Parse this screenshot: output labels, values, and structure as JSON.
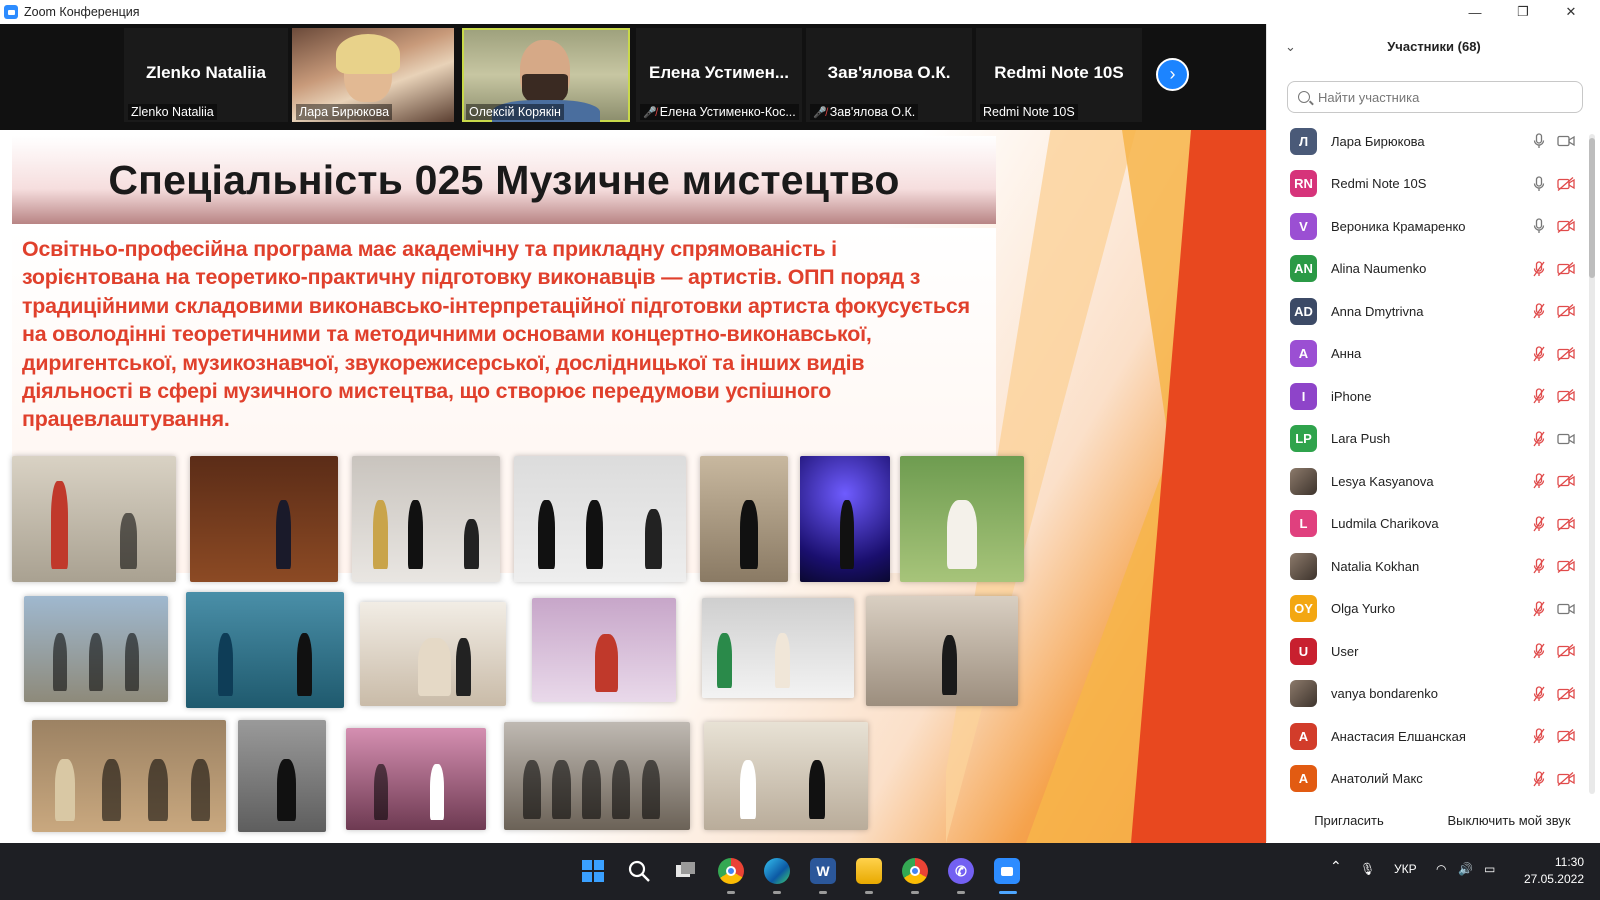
{
  "window": {
    "title": "Zoom Конференция",
    "minimize_icon": "minimize-icon",
    "restore_icon": "restore-icon",
    "close_icon": "close-icon"
  },
  "video_strip": {
    "tiles": [
      {
        "big_name": "Zlenko Nataliia",
        "label": "Zlenko Nataliia",
        "muted": false,
        "video": false
      },
      {
        "big_name": "",
        "label": "Лара Бирюкова",
        "muted": false,
        "video": true
      },
      {
        "big_name": "",
        "label": "Олексій Корякін",
        "muted": false,
        "video": true,
        "active": true
      },
      {
        "big_name": "Елена  Устимен...",
        "label": "Елена Устименко-Кос...",
        "muted": true,
        "video": false
      },
      {
        "big_name": "Зав'ялова О.К.",
        "label": "Зав'ялова О.К.",
        "muted": true,
        "video": false
      },
      {
        "big_name": "Redmi Note 10S",
        "label": "Redmi Note 10S",
        "muted": false,
        "video": false
      }
    ],
    "next_icon": "chevron-right-icon"
  },
  "slide": {
    "title": "Спеціальність 025 Музичне мистецтво",
    "body": "Освітньо-професійна програма має академічну та прикладну спрямованість і зорієнтована на теоретико-практичну підготовку виконавців — артистів. ОПП поряд з традиційними складовими виконавсько-інтерпретаційної підготовки артиста фокусується на оволодінні теоретичними та методичними основами концертно-виконавської, диригентської, музикознавчої, звукорежисерської, дослідницької та інших видів діяльності в сфері музичного мистецтва, що створює передумови успішного працевлаштування.",
    "photo_count": 19
  },
  "participants": {
    "title": "Участники (68)",
    "search_placeholder": "Найти участника",
    "items": [
      {
        "initials": "Л",
        "name": "Лара Бирюкова",
        "color": "#4a5a78",
        "mic_muted": false,
        "cam_off": false
      },
      {
        "initials": "RN",
        "name": "Redmi Note 10S",
        "color": "#d6337a",
        "mic_muted": false,
        "cam_off": true
      },
      {
        "initials": "V",
        "name": "Вероника Крамаренко",
        "color": "#9b4fd3",
        "mic_muted": false,
        "cam_off": true
      },
      {
        "initials": "AN",
        "name": "Alina Naumenko",
        "color": "#2b9a46",
        "mic_muted": true,
        "cam_off": true
      },
      {
        "initials": "AD",
        "name": "Anna Dmytrivna",
        "color": "#3c4a66",
        "mic_muted": true,
        "cam_off": true
      },
      {
        "initials": "A",
        "name": "Анна",
        "color": "#9b4fd3",
        "mic_muted": true,
        "cam_off": true
      },
      {
        "initials": "I",
        "name": "iPhone",
        "color": "#8e44c9",
        "mic_muted": true,
        "cam_off": true
      },
      {
        "initials": "LP",
        "name": "Lara Push",
        "color": "#2fa34c",
        "mic_muted": true,
        "cam_off": false
      },
      {
        "initials": "",
        "name": "Lesya Kasyanova",
        "color": "photo",
        "mic_muted": true,
        "cam_off": true
      },
      {
        "initials": "L",
        "name": "Ludmila Charikova",
        "color": "#e0407e",
        "mic_muted": true,
        "cam_off": true
      },
      {
        "initials": "",
        "name": "Natalia  Kokhan",
        "color": "photo",
        "mic_muted": true,
        "cam_off": true
      },
      {
        "initials": "OY",
        "name": "Olga Yurko",
        "color": "#f3a712",
        "mic_muted": true,
        "cam_off": false
      },
      {
        "initials": "U",
        "name": "User",
        "color": "#c8202f",
        "mic_muted": true,
        "cam_off": true
      },
      {
        "initials": "",
        "name": "vanya bondarenko",
        "color": "photo",
        "mic_muted": true,
        "cam_off": true
      },
      {
        "initials": "A",
        "name": "Анастасия Елшанская",
        "color": "#d23c2a",
        "mic_muted": true,
        "cam_off": true
      },
      {
        "initials": "A",
        "name": "Анатолий Макс",
        "color": "#e25b12",
        "mic_muted": true,
        "cam_off": true
      }
    ],
    "invite_label": "Пригласить",
    "mute_me_label": "Выключить мой звук"
  },
  "taskbar": {
    "apps": [
      "windows-start-icon",
      "search-icon",
      "task-view-icon",
      "chrome-icon",
      "edge-icon",
      "word-icon",
      "file-explorer-icon",
      "chrome-profile-icon",
      "viber-icon",
      "zoom-icon"
    ],
    "language": "УКР",
    "time": "11:30",
    "date": "27.05.2022"
  }
}
